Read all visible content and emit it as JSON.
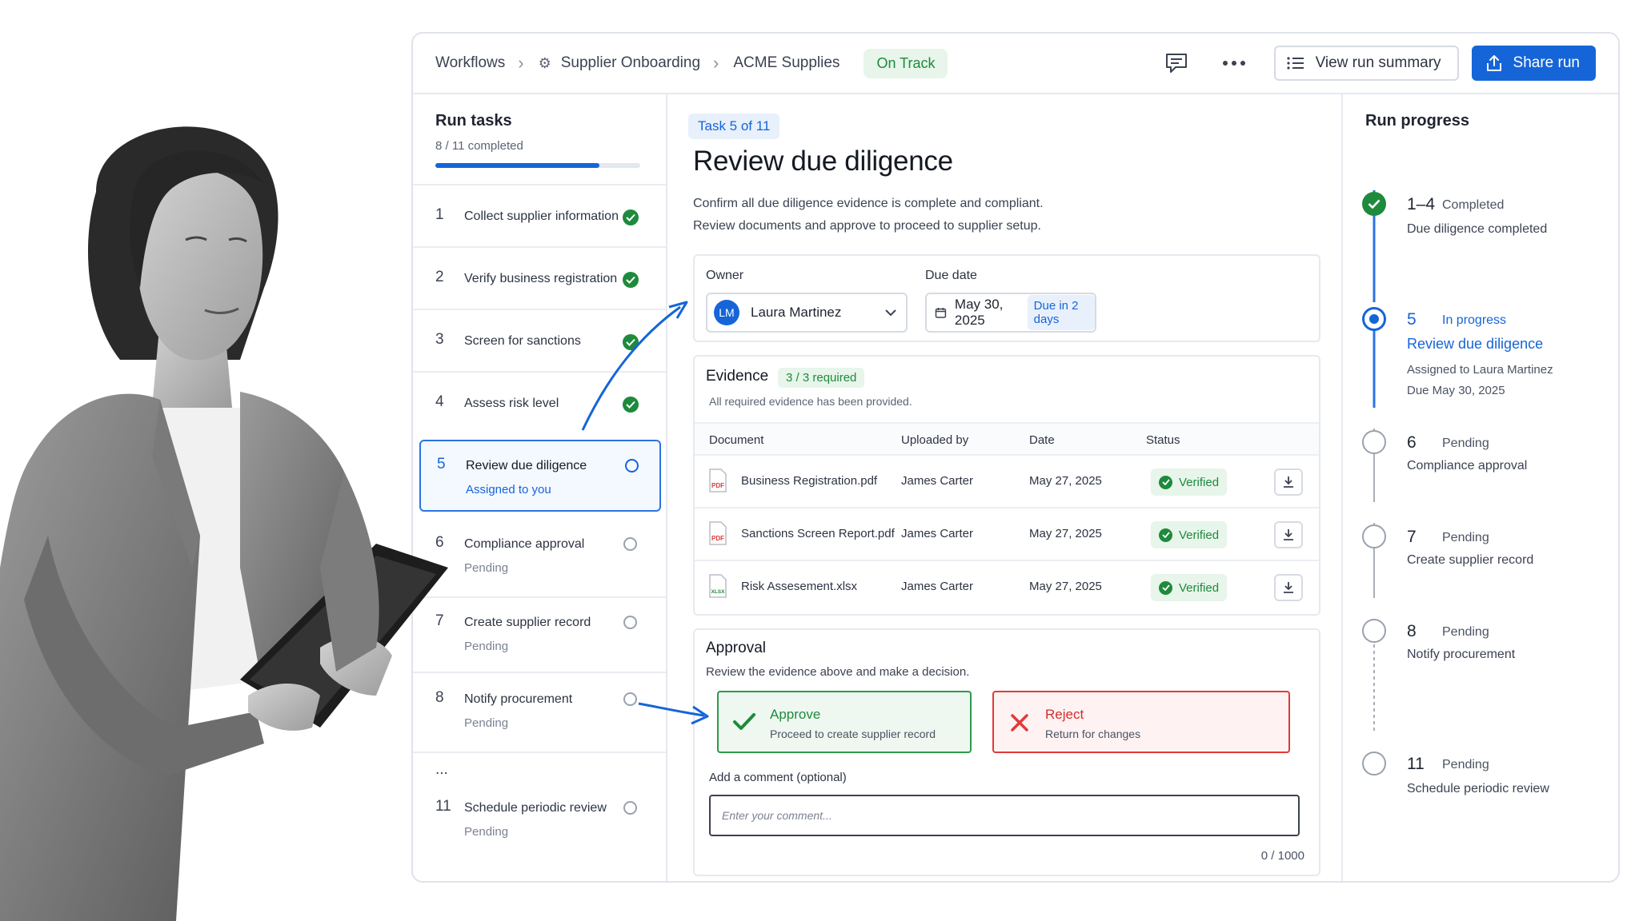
{
  "breadcrumb": {
    "workflows": "Workflows",
    "workflow": "Supplier Onboarding",
    "run": "ACME Supplies",
    "status": "On Track"
  },
  "topbar": {
    "comment_icon": "comment-icon",
    "more_icon": "more-icon",
    "view_summary": "View run summary",
    "share": "Share run"
  },
  "run_tasks": {
    "title": "Run tasks",
    "completed_text": "8 / 11 completed",
    "progress": 0.8,
    "items": [
      {
        "num": "1",
        "label": "Collect supplier information",
        "sub": "",
        "state": "done"
      },
      {
        "num": "2",
        "label": "Verify business registration",
        "sub": "",
        "state": "done"
      },
      {
        "num": "3",
        "label": "Screen for sanctions",
        "sub": "",
        "state": "done"
      },
      {
        "num": "4",
        "label": "Assess risk level",
        "sub": "",
        "state": "done"
      },
      {
        "num": "5",
        "label": "Review due diligence",
        "sub": "Assigned to you",
        "state": "active"
      },
      {
        "num": "6",
        "label": "Compliance approval",
        "sub": "Pending",
        "state": "pending"
      },
      {
        "num": "7",
        "label": "Create supplier record",
        "sub": "Pending",
        "state": "pending"
      },
      {
        "num": "8",
        "label": "Notify procurement",
        "sub": "Pending",
        "state": "pending"
      },
      {
        "num": "11",
        "label": "Schedule periodic review",
        "sub": "Pending",
        "state": "pending"
      }
    ],
    "ellipsis": "..."
  },
  "task": {
    "chip": "Task 5 of 11",
    "title": "Review due diligence",
    "desc_line1": "Confirm all due diligence evidence is complete and compliant.",
    "desc_line2": "Review documents and approve to proceed to supplier setup."
  },
  "owner": {
    "label": "Owner",
    "initials": "LM",
    "name": "Laura Martinez"
  },
  "due": {
    "label": "Due date",
    "date": "May 30, 2025",
    "badge": "Due in 2 days"
  },
  "evidence": {
    "title": "Evidence",
    "badge": "3 / 3 required",
    "subtitle": "All required evidence has been provided.",
    "columns": [
      "Document",
      "Uploaded by",
      "Date",
      "Status"
    ],
    "rows": [
      {
        "type": "PDF",
        "name": "Business Registration.pdf",
        "by": "James Carter",
        "date": "May 27, 2025",
        "status": "Verified"
      },
      {
        "type": "PDF",
        "name": "Sanctions Screen Report.pdf",
        "by": "James Carter",
        "date": "May 27, 2025",
        "status": "Verified"
      },
      {
        "type": "XLSX",
        "name": "Risk Assesement.xlsx",
        "by": "James Carter",
        "date": "May 27, 2025",
        "status": "Verified"
      }
    ]
  },
  "approval": {
    "title": "Approval",
    "subtitle": "Review the evidence above and make a decision.",
    "approve_title": "Approve",
    "approve_sub": "Proceed to create supplier record",
    "reject_title": "Reject",
    "reject_sub": "Return for changes",
    "comment_label": "Add a comment (optional)",
    "comment_placeholder": "Enter your comment...",
    "counter": "0 / 1000"
  },
  "run_progress": {
    "title": "Run progress",
    "steps": [
      {
        "num": "1–4",
        "status": "Completed",
        "label": "Due diligence completed"
      },
      {
        "num": "5",
        "status": "In progress",
        "label": "Review due diligence",
        "detail1": "Assigned to Laura Martinez",
        "detail2": "Due May 30, 2025"
      },
      {
        "num": "6",
        "status": "Pending",
        "label": "Compliance approval"
      },
      {
        "num": "7",
        "status": "Pending",
        "label": "Create supplier record"
      },
      {
        "num": "8",
        "status": "Pending",
        "label": "Notify procurement"
      },
      {
        "num": "11",
        "status": "Pending",
        "label": "Schedule periodic review"
      }
    ]
  },
  "colors": {
    "accent": "#1565d8",
    "success": "#1e8a3c",
    "danger": "#e03a3a"
  }
}
